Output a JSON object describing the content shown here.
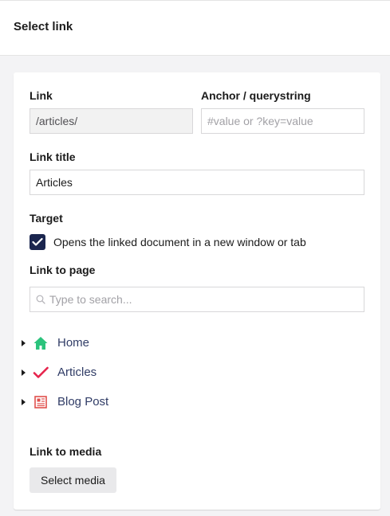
{
  "header": {
    "title": "Select link"
  },
  "form": {
    "link": {
      "label": "Link",
      "value": "/articles/"
    },
    "anchor": {
      "label": "Anchor / querystring",
      "placeholder": "#value or ?key=value"
    },
    "link_title": {
      "label": "Link title",
      "value": "Articles"
    },
    "target": {
      "label": "Target",
      "checkbox_label": "Opens the linked document in a new window or tab",
      "checked": true
    },
    "link_to_page": {
      "label": "Link to page",
      "search_placeholder": "Type to search...",
      "tree": [
        {
          "label": "Home",
          "icon": "home-icon",
          "color": "#2bc37c"
        },
        {
          "label": "Articles",
          "icon": "checkmark-icon",
          "color": "#e6244c"
        },
        {
          "label": "Blog Post",
          "icon": "newspaper-icon",
          "color": "#e0504c"
        }
      ]
    },
    "link_to_media": {
      "label": "Link to media",
      "button": "Select media"
    }
  },
  "colors": {
    "accent": "#1b264f",
    "node_text": "#303c66"
  }
}
